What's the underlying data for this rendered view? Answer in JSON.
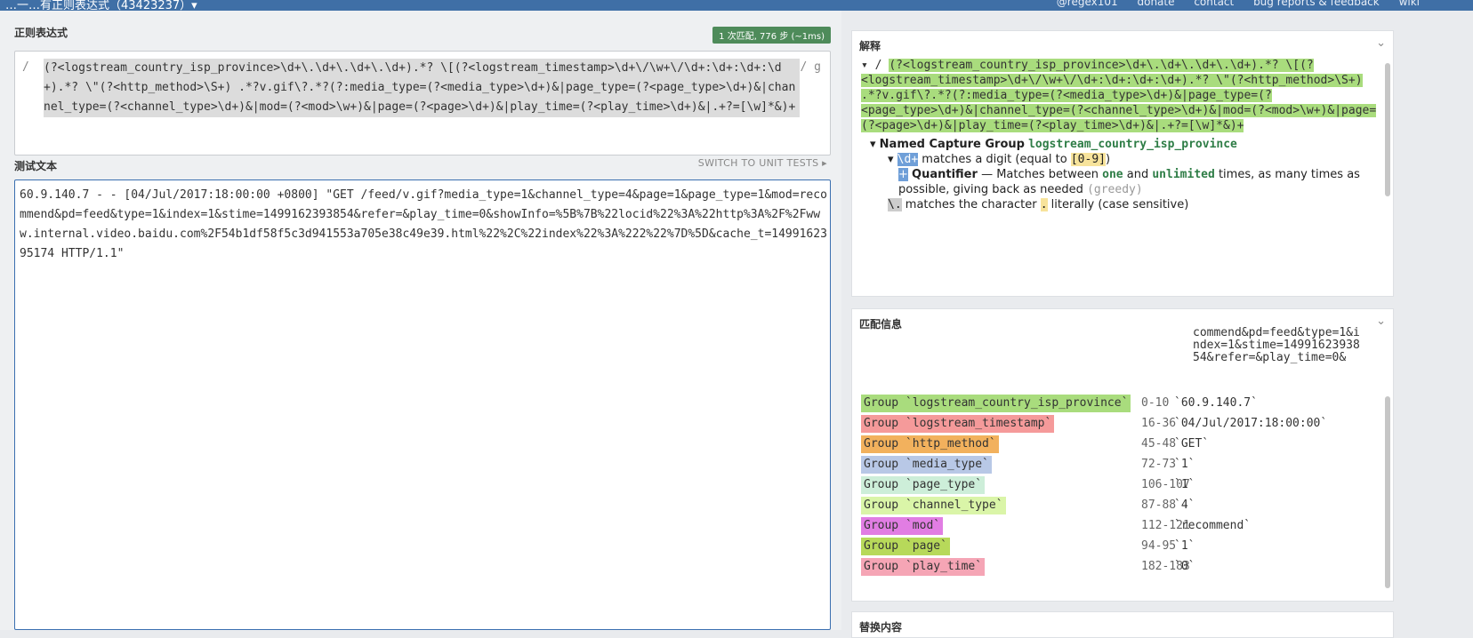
{
  "header": {
    "title": "…一…有正则表达式（43423237）▾",
    "links": [
      "@regex101",
      "donate",
      "contact",
      "bug reports & feedback",
      "wiki"
    ]
  },
  "regex_section": {
    "label": "正则表达式",
    "badge": "1 次匹配, 776 步 (~1ms)",
    "delimiter": "/",
    "flags": "/ g",
    "pattern": "(?<logstream_country_isp_province>\\d+\\.\\d+\\.\\d+\\.\\d+).*? \\[(?<logstream_timestamp>\\d+\\/\\w+\\/\\d+:\\d+:\\d+:\\d+).*? \\\"(?<http_method>\\S+) .*?v.gif\\?.*?(?:media_type=(?<media_type>\\d+)&|page_type=(?<page_type>\\d+)&|channel_type=(?<channel_type>\\d+)&|mod=(?<mod>\\w+)&|page=(?<page>\\d+)&|play_time=(?<play_time>\\d+)&|.+?=[\\w]*&)+"
  },
  "test_section": {
    "label": "测试文本",
    "switch_label": "SWITCH TO UNIT TESTS",
    "text": "60.9.140.7 - - [04/Jul/2017:18:00:00 +0800] \"GET /feed/v.gif?media_type=1&channel_type=4&page=1&page_type=1&mod=recommend&pd=feed&type=1&index=1&stime=1499162393854&refer=&play_time=0&showInfo=%5B%7B%22locid%22%3A%22http%3A%2F%2Fwww.internal.video.baidu.com%2F54b1df58f5c3d941553a705e38c49e39.html%22%2C%22index%22%3A%222%22%7D%5D&cache_t=1499162395174 HTTP/1.1\""
  },
  "explanation": {
    "label": "解释",
    "named_group_title": "Named Capture Group",
    "named_group_name": "logstream_country_isp_province",
    "matches_digit": "matches a digit (equal to",
    "digit_class": "[0-9]",
    "quantifier": "Quantifier",
    "quantifier_desc_1": "— Matches between",
    "one": "one",
    "and": "and",
    "unlimited": "unlimited",
    "times": "times, as many times",
    "as_possible": "as possible, giving back as needed",
    "greedy": "(greedy)",
    "dot_desc": "matches the character",
    "dot_char": ".",
    "literally": "literally (case sensitive)"
  },
  "match_info": {
    "label": "匹配信息",
    "overflow_text": "commend&pd=feed&type=1&index=1&stime=14991623938 54&refer=&play_time=0&",
    "groups": [
      {
        "name": "Group `logstream_country_isp_province`",
        "range": "0-10",
        "value": "`60.9.140.7`",
        "color": "#a9dc7d"
      },
      {
        "name": "Group `logstream_timestamp`",
        "range": "16-36",
        "value": "`04/Jul/2017:18:00:00`",
        "color": "#f59a9a"
      },
      {
        "name": "Group `http_method`",
        "range": "45-48",
        "value": "`GET`",
        "color": "#f2b15d"
      },
      {
        "name": "Group `media_type`",
        "range": "72-73",
        "value": "`1`",
        "color": "#b8c8e6"
      },
      {
        "name": "Group `page_type`",
        "range": "106-107",
        "value": "`1`",
        "color": "#cdeed9"
      },
      {
        "name": "Group `channel_type`",
        "range": "87-88",
        "value": "`4`",
        "color": "#daf5a8"
      },
      {
        "name": "Group `mod`",
        "range": "112-121",
        "value": "`recommend`",
        "color": "#e17de3"
      },
      {
        "name": "Group `page`",
        "range": "94-95",
        "value": "`1`",
        "color": "#b7d95a"
      },
      {
        "name": "Group `play_time`",
        "range": "182-183",
        "value": "`0`",
        "color": "#f5a5b5"
      }
    ]
  },
  "bottom_panel": {
    "label": "替换内容"
  }
}
